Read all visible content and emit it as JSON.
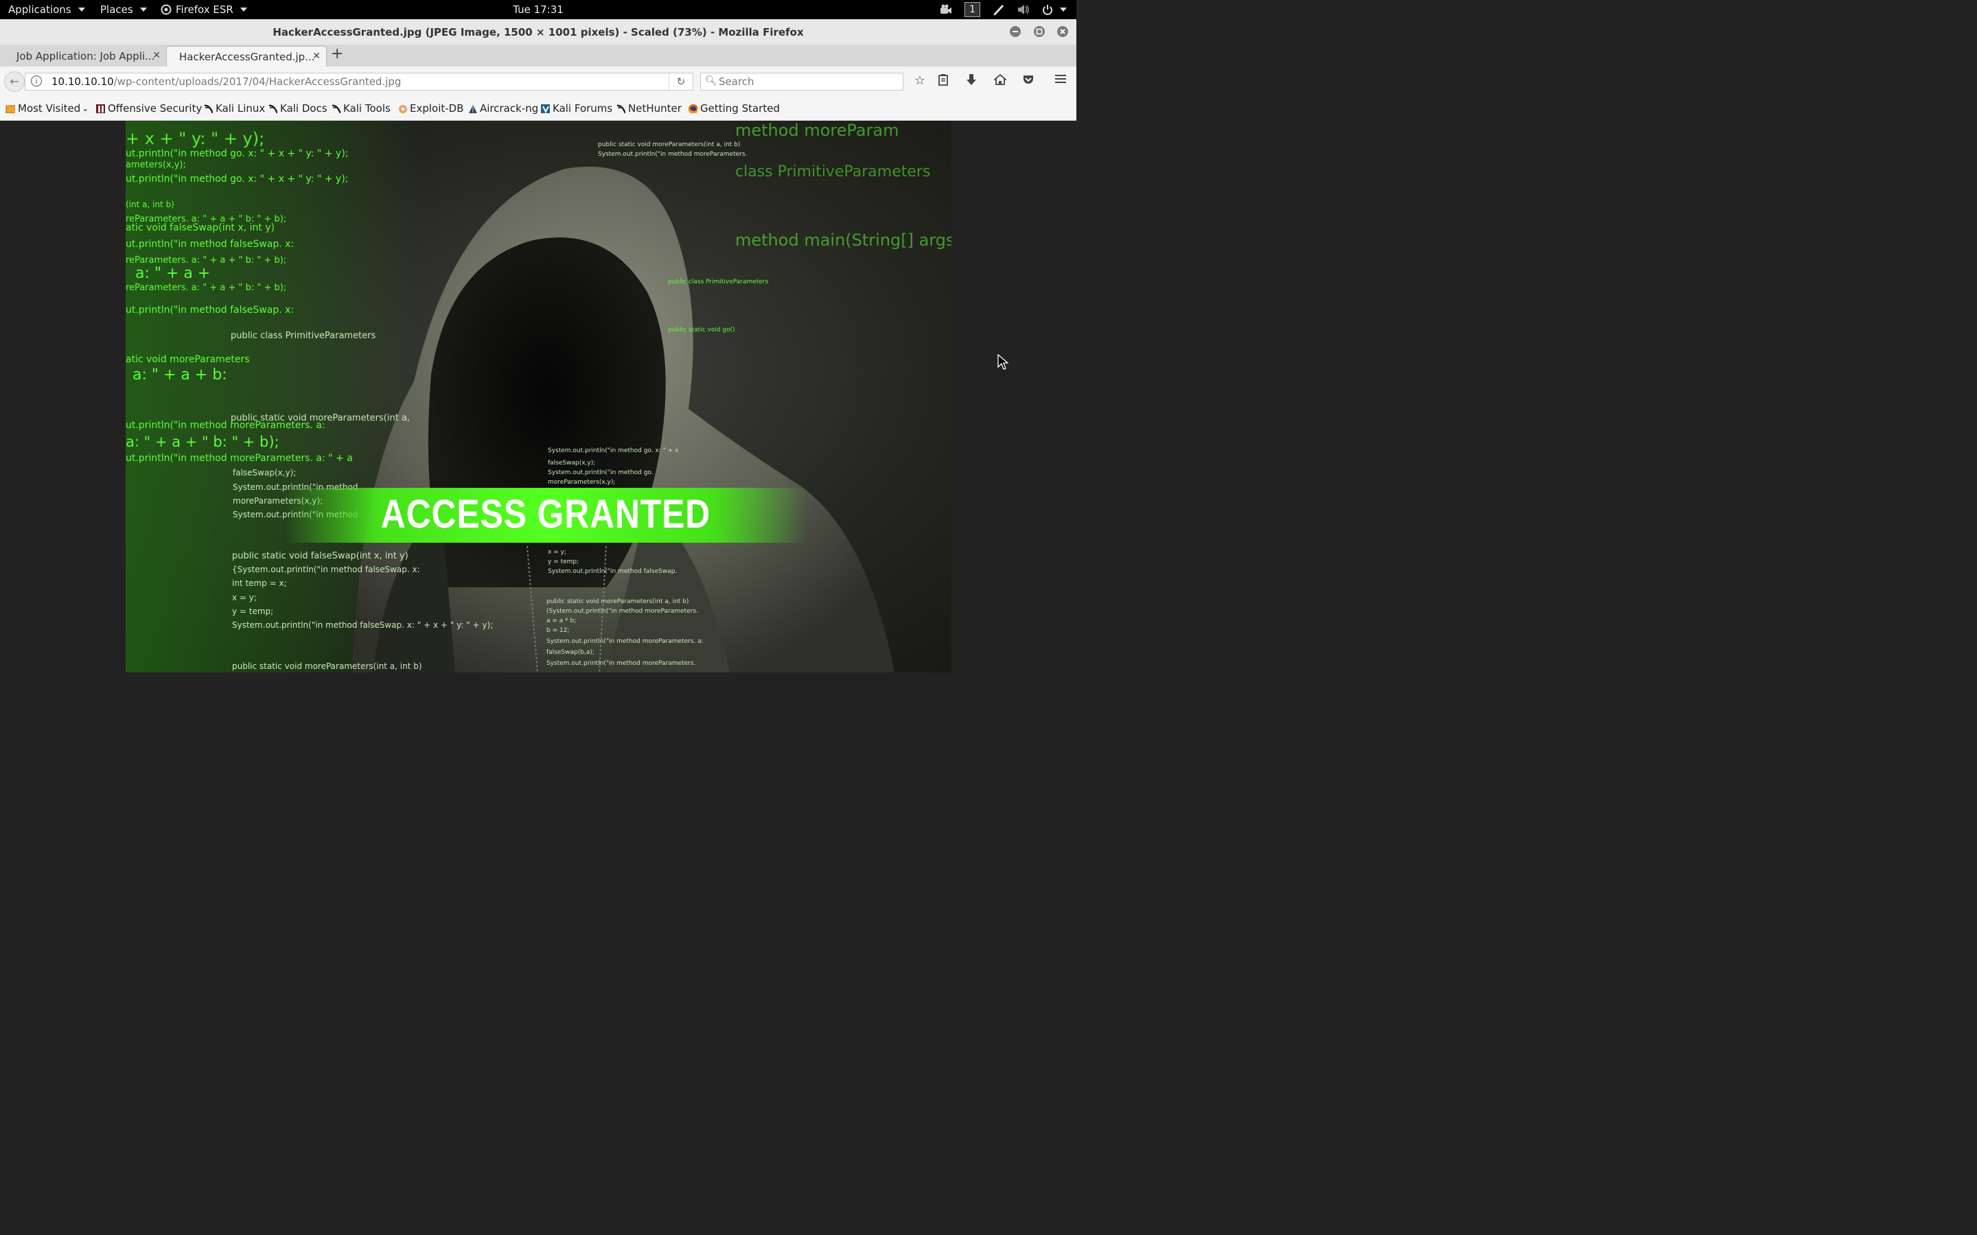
{
  "topbar": {
    "applications": "Applications",
    "places": "Places",
    "app_name": "Firefox ESR",
    "clock": "Tue 17:31",
    "workspace": "1"
  },
  "window": {
    "title": "HackerAccessGranted.jpg (JPEG Image, 1500 × 1001 pixels) - Scaled (73%) - Mozilla Firefox"
  },
  "tabs": [
    {
      "label": "Job Application: Job Appli...",
      "active": false
    },
    {
      "label": "HackerAccessGranted.jp...",
      "active": true
    }
  ],
  "nav": {
    "url_host": "10.10.10.10",
    "url_path": "/wp-content/uploads/2017/04/HackerAccessGranted.jpg",
    "search_placeholder": "Search"
  },
  "bookmarks": [
    {
      "label": "Most Visited",
      "icon": "folder-icon"
    },
    {
      "label": "Offensive Security",
      "icon": "offsec-icon"
    },
    {
      "label": "Kali Linux",
      "icon": "kali-dragon-icon"
    },
    {
      "label": "Kali Docs",
      "icon": "kali-dragon-icon"
    },
    {
      "label": "Kali Tools",
      "icon": "kali-dragon-icon"
    },
    {
      "label": "Exploit-DB",
      "icon": "exploitdb-icon"
    },
    {
      "label": "Aircrack-ng",
      "icon": "aircrack-icon"
    },
    {
      "label": "Kali Forums",
      "icon": "kali-forums-icon"
    },
    {
      "label": "NetHunter",
      "icon": "kali-dragon-icon"
    },
    {
      "label": "Getting Started",
      "icon": "firefox-icon"
    }
  ],
  "image": {
    "banner_text": "ACCESS GRANTED",
    "code_lines": [
      "+ x + \" y: \" + y);",
      "ut.println(\"in method go. x: \" + x + \" y: \" + y);",
      "ameters(x,y);",
      "ut.println(\"in method go. x: \" + x + \" y: \" + y);",
      "(int a, int b)",
      "reParameters. a: \" + a + \" b: \" + b);",
      "atic void falseSwap(int x, int y)",
      "ut.println(\"in method falseSwap. x:",
      "reParameters. a: \" + a + \" b: \" + b);",
      "a: \" + a +",
      "reParameters. a: \" + a + \" b: \" + b);",
      "ut.println(\"in method falseSwap. x:",
      "public class PrimitiveParameters",
      "atic void moreParameters",
      "a: \" + a + b:",
      "public static void moreParameters(int a,",
      "ut.println(\"in method moreParameters. a:",
      "a: \" + a + \" b: \" + b);",
      "ut.println(\"in method moreParameters. a: \" + a",
      "falseSwap(x,y);",
      "System.out.println(\"in method",
      "moreParameters(x,y);",
      "System.out.println(\"in method",
      "public static void falseSwap(int x, int y)",
      "{System.out.println(\"in method falseSwap. x:",
      "int temp = x;",
      "x = y;",
      "y = temp;",
      "System.out.println(\"in method falseSwap. x: \" + x + \" y: \" + y);",
      "public static void moreParameters(int a, int b)"
    ],
    "right_code": [
      "public static void moreParameters(int a, int b)",
      "System.out.println(\"in method moreParameters.",
      "method moreParam",
      "class PrimitiveParameters",
      "method main(String[] args",
      "public class PrimitiveParameters",
      "public static void go()",
      "System.out.println(\"in method go. x: \" + x",
      "falseSwap(x,y);",
      "System.out.println(\"in method go.",
      "moreParameters(x,y);",
      "x = y;",
      "y = temp;",
      "System.out.println(\"in method falseSwap.",
      "public static void moreParameters(int a, int b)",
      "(System.out.println(\"in method moreParameters.",
      "a = a * b;",
      "b = 12;",
      "System.out.println(\"in method moreParameters. a:",
      "falseSwap(b,a);",
      "System.out.println(\"in method moreParameters."
    ]
  }
}
